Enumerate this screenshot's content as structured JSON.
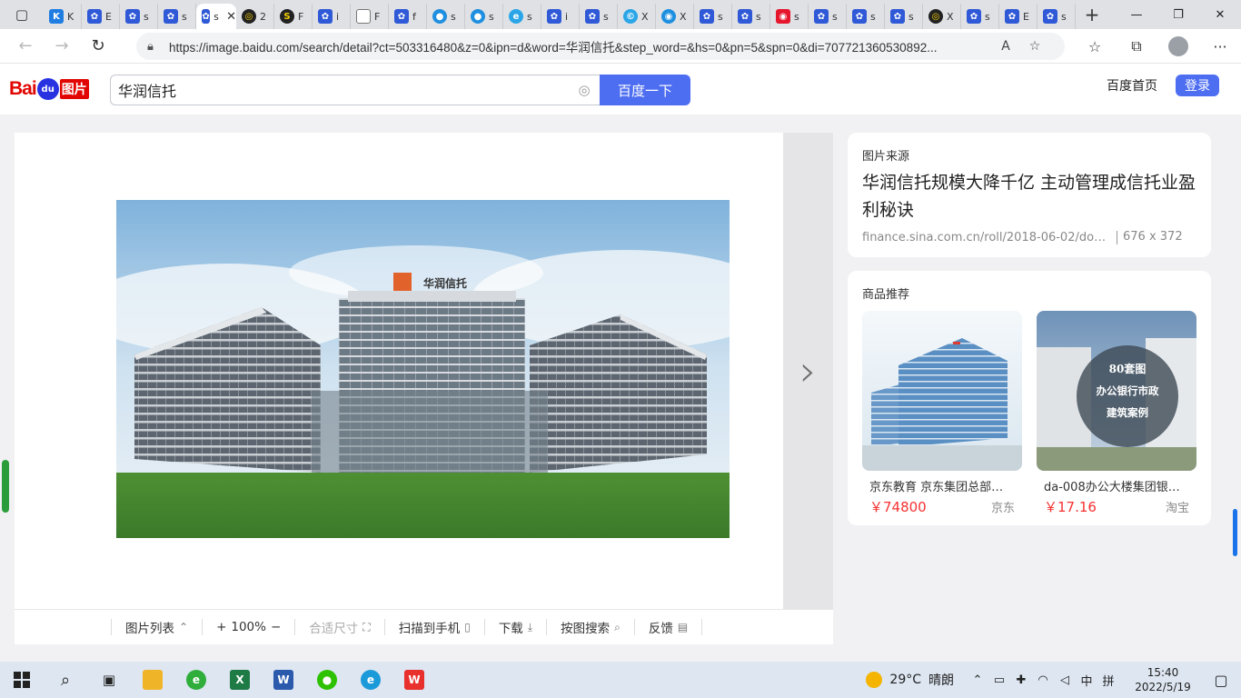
{
  "browser": {
    "tabs": [
      {
        "icon": "k-icon",
        "short": "K"
      },
      {
        "icon": "paw-icon",
        "short": "E"
      },
      {
        "icon": "paw-icon",
        "short": "s"
      },
      {
        "icon": "paw-icon",
        "short": "s"
      },
      {
        "icon": "paw-icon",
        "short": "s",
        "active": true
      },
      {
        "icon": "yellow-icon",
        "short": "2"
      },
      {
        "icon": "s-icon",
        "short": "F"
      },
      {
        "icon": "paw-icon",
        "short": "i"
      },
      {
        "icon": "doc-icon",
        "short": "F"
      },
      {
        "icon": "paw-icon",
        "short": "f"
      },
      {
        "icon": "circle-icon",
        "short": "s"
      },
      {
        "icon": "circle-icon",
        "short": "s"
      },
      {
        "icon": "edge-icon",
        "short": "s"
      },
      {
        "icon": "paw-icon",
        "short": "i"
      },
      {
        "icon": "paw-icon",
        "short": "s"
      },
      {
        "icon": "cyan-icon",
        "short": "X"
      },
      {
        "icon": "eye-icon",
        "short": "X"
      },
      {
        "icon": "paw-icon",
        "short": "s"
      },
      {
        "icon": "paw-icon",
        "short": "s"
      },
      {
        "icon": "weibo-icon",
        "short": "s"
      },
      {
        "icon": "paw-icon",
        "short": "s"
      },
      {
        "icon": "paw-icon",
        "short": "s"
      },
      {
        "icon": "paw-icon",
        "short": "s"
      },
      {
        "icon": "yellow-icon",
        "short": "X"
      },
      {
        "icon": "paw-icon",
        "short": "s"
      },
      {
        "icon": "paw-icon",
        "short": "E"
      },
      {
        "icon": "paw-icon",
        "short": "s"
      }
    ],
    "url": "https://image.baidu.com/search/detail?ct=503316480&z=0&ipn=d&word=华润信托&step_word=&hs=0&pn=5&spn=0&di=707721360530892..."
  },
  "baidu": {
    "logo_text": "Bai",
    "logo_du": "du",
    "logo_pic": "图片",
    "query": "华润信托",
    "search_button": "百度一下",
    "home_link": "百度首页",
    "login": "登录"
  },
  "viewer": {
    "image_caption_logo": "华润信托",
    "next_arrow": "›",
    "toolbar": {
      "list": "图片列表",
      "zoom_in": "+",
      "zoom": "100%",
      "zoom_out": "−",
      "fit": "合适尺寸",
      "scan": "扫描到手机",
      "download": "下载",
      "search_by_image": "按图搜索",
      "feedback": "反馈"
    }
  },
  "source": {
    "label": "图片来源",
    "title": "华润信托规模大降千亿 主动管理成信托业盈利秘诀",
    "url": "finance.sina.com.cn/roll/2018-06-02/doc-...",
    "size": "676 x 372"
  },
  "goods": {
    "label": "商品推荐",
    "items": [
      {
        "name": "京东教育 京东集团总部研…",
        "price": "￥74800",
        "shop": "京东"
      },
      {
        "name": "da-008办公大楼集团银行…",
        "price": "￥17.16",
        "shop": "淘宝",
        "overlay_1": "80套图",
        "overlay_2": "办公银行市政",
        "overlay_3": "建筑案例"
      }
    ]
  },
  "taskbar": {
    "weather_temp": "29°C",
    "weather_text": "晴朗",
    "ime_lang": "中",
    "ime_mode": "拼",
    "time": "15:40",
    "date": "2022/5/19"
  }
}
